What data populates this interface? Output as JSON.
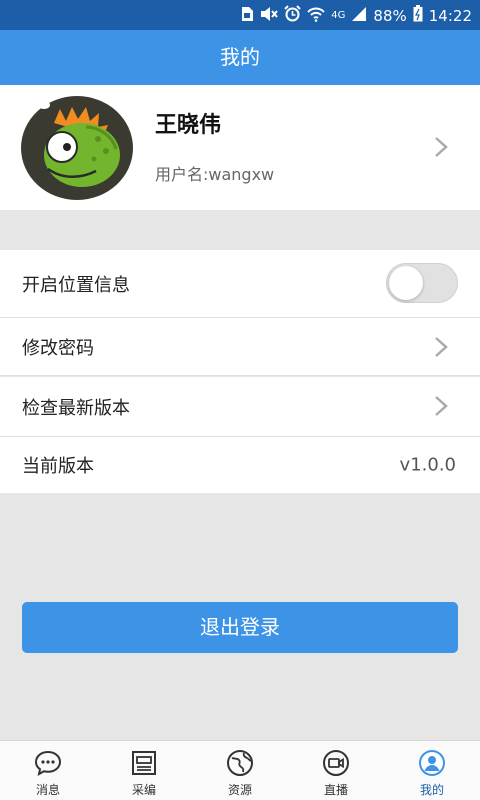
{
  "status_bar": {
    "network": "4G",
    "battery": "88%",
    "time": "14:22"
  },
  "title": "我的",
  "profile": {
    "name": "王晓伟",
    "username": "用户名:wangxw"
  },
  "settings": {
    "location": {
      "label": "开启位置信息",
      "enabled": false
    },
    "change_password": {
      "label": "修改密码"
    },
    "check_update": {
      "label": "检查最新版本"
    },
    "current_version": {
      "label": "当前版本",
      "value": "v1.0.0"
    }
  },
  "logout_label": "退出登录",
  "tabs": [
    {
      "label": "消息",
      "icon": "chat-bubble-icon",
      "active": false
    },
    {
      "label": "采编",
      "icon": "newspaper-icon",
      "active": false
    },
    {
      "label": "资源",
      "icon": "globe-icon",
      "active": false
    },
    {
      "label": "直播",
      "icon": "video-camera-icon",
      "active": false
    },
    {
      "label": "我的",
      "icon": "user-icon",
      "active": true
    }
  ],
  "colors": {
    "primary": "#3d94e6",
    "status_bar": "#1c5ea8",
    "background": "#e6e6e6"
  }
}
